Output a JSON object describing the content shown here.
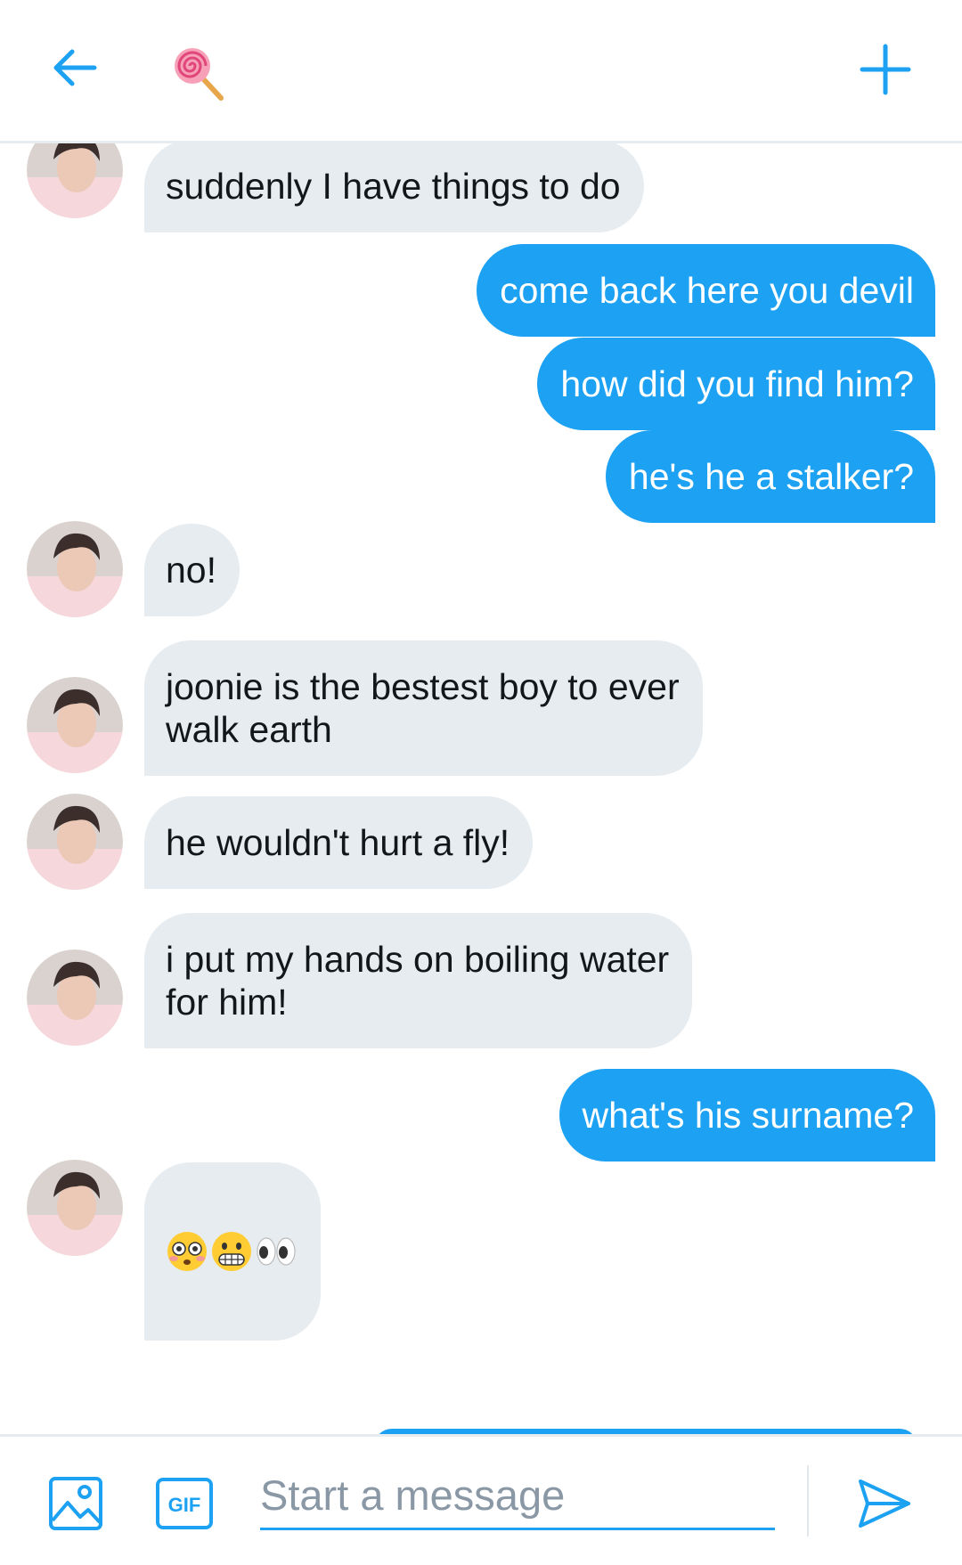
{
  "header": {
    "back_icon": "arrow-left-icon",
    "profile_emoji": "lollipop",
    "new_icon": "plus-icon",
    "accent": "#1da1f2"
  },
  "messages": [
    {
      "from": "them",
      "text": "suddenly I have things to do"
    },
    {
      "from": "me",
      "text": "come back here you devil"
    },
    {
      "from": "me",
      "text": "how did you find him?"
    },
    {
      "from": "me",
      "text": "he's he a stalker?"
    },
    {
      "from": "them",
      "text": "no!"
    },
    {
      "from": "them",
      "text": "joonie is the bestest boy to ever\nwalk earth"
    },
    {
      "from": "them",
      "text": "he wouldn't hurt a fly!"
    },
    {
      "from": "them",
      "text": "i put my hands on boiling water\nfor him!"
    },
    {
      "from": "me",
      "text": "what's his surname?"
    },
    {
      "from": "them",
      "emojis": [
        "flushed-face",
        "grimacing-face",
        "eyes"
      ]
    }
  ],
  "composer": {
    "placeholder": "Start a message",
    "image_icon": "image-icon",
    "gif_label": "GIF",
    "send_icon": "send-icon"
  },
  "colors": {
    "incoming_bubble": "#e6ecf0",
    "outgoing_bubble": "#1da1f2",
    "text_dark": "#14171a"
  }
}
